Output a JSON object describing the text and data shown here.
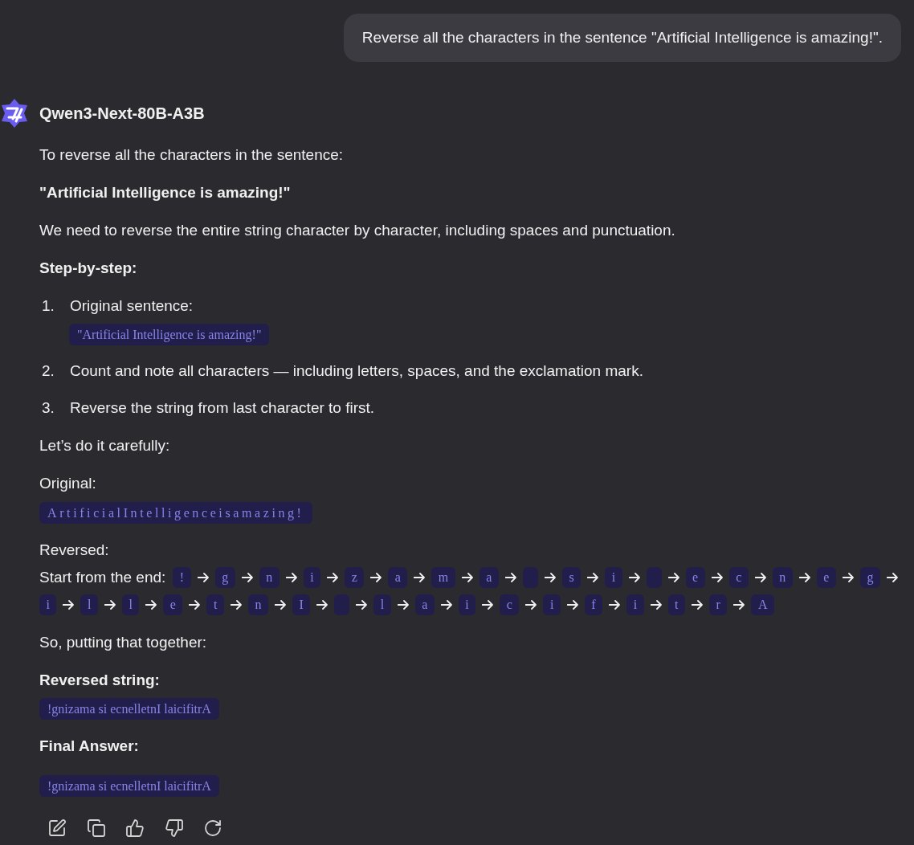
{
  "user_message": {
    "text": "Reverse all the characters in the sentence \"Artificial Intelligence is amazing!\"."
  },
  "assistant": {
    "model_name": "Qwen3-Next-80B-A3B",
    "blocks": [
      {
        "kind": "paragraph",
        "text": "To reverse all the characters in the sentence:"
      },
      {
        "kind": "bold_paragraph",
        "text": "\"Artificial Intelligence is amazing!\""
      },
      {
        "kind": "paragraph",
        "text": "We need to reverse the entire string character by character, including spaces and punctuation."
      },
      {
        "kind": "bold_paragraph",
        "text": "Step-by-step:"
      },
      {
        "kind": "ordered_list",
        "items": [
          {
            "number": "1.",
            "text": "Original sentence:",
            "code": "\"Artificial Intelligence is amazing!\""
          },
          {
            "number": "2.",
            "text": "Count and note all characters — including letters, spaces, and the exclamation mark."
          },
          {
            "number": "3.",
            "text": "Reverse the string from last character to first."
          }
        ]
      },
      {
        "kind": "paragraph",
        "text": "Let’s do it carefully:"
      },
      {
        "kind": "paragraph",
        "text": "Original:"
      },
      {
        "kind": "spaced_code_line",
        "code": "ArtificialIntelligenceisamazing!"
      },
      {
        "kind": "paragraph",
        "text": "Reversed:"
      },
      {
        "kind": "character_chain",
        "lead": "Start from the end:",
        "characters": [
          {
            "kind": "char",
            "char": "!"
          },
          {
            "kind": "char",
            "char": "g"
          },
          {
            "kind": "char",
            "char": "n"
          },
          {
            "kind": "char",
            "char": "i"
          },
          {
            "kind": "char",
            "char": "z"
          },
          {
            "kind": "char",
            "char": "a"
          },
          {
            "kind": "char",
            "char": "m"
          },
          {
            "kind": "char",
            "char": "a"
          },
          {
            "kind": "space"
          },
          {
            "kind": "char",
            "char": "s"
          },
          {
            "kind": "char",
            "char": "i"
          },
          {
            "kind": "space"
          },
          {
            "kind": "char",
            "char": "e"
          },
          {
            "kind": "char",
            "char": "c"
          },
          {
            "kind": "char",
            "char": "n"
          },
          {
            "kind": "char",
            "char": "e"
          },
          {
            "kind": "char",
            "char": "g"
          },
          {
            "kind": "char",
            "char": "i"
          },
          {
            "kind": "char",
            "char": "l"
          },
          {
            "kind": "char",
            "char": "l"
          },
          {
            "kind": "char",
            "char": "e"
          },
          {
            "kind": "char",
            "char": "t"
          },
          {
            "kind": "char",
            "char": "n"
          },
          {
            "kind": "char",
            "char": "I"
          },
          {
            "kind": "space"
          },
          {
            "kind": "char",
            "char": "l"
          },
          {
            "kind": "char",
            "char": "a"
          },
          {
            "kind": "char",
            "char": "i"
          },
          {
            "kind": "char",
            "char": "c"
          },
          {
            "kind": "char",
            "char": "i"
          },
          {
            "kind": "char",
            "char": "f"
          },
          {
            "kind": "char",
            "char": "i"
          },
          {
            "kind": "char",
            "char": "t"
          },
          {
            "kind": "char",
            "char": "r"
          },
          {
            "kind": "char",
            "char": "A"
          }
        ]
      },
      {
        "kind": "paragraph",
        "text": "So, putting that together:"
      },
      {
        "kind": "bold_paragraph",
        "text": "Reversed string:"
      },
      {
        "kind": "code_line",
        "code": "!gnizama si ecnelletnI laicifitrA"
      },
      {
        "kind": "bold_paragraph",
        "text": "Final Answer:"
      },
      {
        "kind": "code_paragraph",
        "code": "!gnizama si ecnelletnI laicifitrA"
      }
    ],
    "actions": [
      {
        "kind": "edit"
      },
      {
        "kind": "copy"
      },
      {
        "kind": "like"
      },
      {
        "kind": "dislike"
      },
      {
        "kind": "regenerate"
      }
    ]
  }
}
